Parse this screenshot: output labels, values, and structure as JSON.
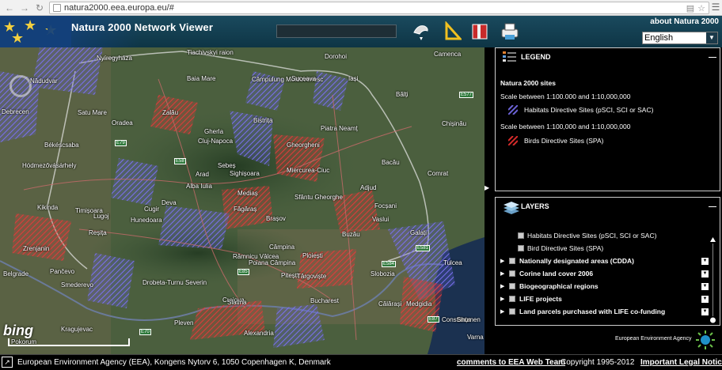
{
  "browser": {
    "url": "natura2000.eea.europa.eu/#",
    "back_icon": "back-arrow-icon",
    "forward_icon": "forward-arrow-icon",
    "reload_icon": "reload-icon"
  },
  "header": {
    "title": "Natura 2000 Network Viewer",
    "about_link": "about Natura 2000",
    "language": "English",
    "tools": [
      "map-tools-icon",
      "measure-icon",
      "bookmark-icon",
      "print-icon"
    ]
  },
  "map": {
    "provider": "bing",
    "cities": [
      {
        "name": "Tiachivskyi raion"
      },
      {
        "name": "Dorohoi"
      },
      {
        "name": "Camenca"
      },
      {
        "name": "Nyíregyháza"
      },
      {
        "name": "Baia Mare"
      },
      {
        "name": "Câmpulung Moldovenesc"
      },
      {
        "name": "Suceava"
      },
      {
        "name": "Iași"
      },
      {
        "name": "Bălți"
      },
      {
        "name": "Nădudvar"
      },
      {
        "name": "Debrecen"
      },
      {
        "name": "Satu Mare"
      },
      {
        "name": "Zalău"
      },
      {
        "name": "Bistrița"
      },
      {
        "name": "Oradea"
      },
      {
        "name": "Gherla"
      },
      {
        "name": "Cluj-Napoca"
      },
      {
        "name": "Piatra Neamț"
      },
      {
        "name": "Chișinău"
      },
      {
        "name": "Békéscsaba"
      },
      {
        "name": "Gheorgheni"
      },
      {
        "name": "Bacău"
      },
      {
        "name": "Hódmezővásárhely"
      },
      {
        "name": "Arad"
      },
      {
        "name": "Miercurea-Ciuc"
      },
      {
        "name": "Comrat"
      },
      {
        "name": "Kikinda"
      },
      {
        "name": "Timișoara"
      },
      {
        "name": "Deva"
      },
      {
        "name": "Alba Iulia"
      },
      {
        "name": "Sfântu Gheorghe"
      },
      {
        "name": "Adjud"
      },
      {
        "name": "Focșani"
      },
      {
        "name": "Brașov"
      },
      {
        "name": "Râmnicu Vâlcea"
      },
      {
        "name": "Câmpina"
      },
      {
        "name": "Buzău"
      },
      {
        "name": "Galați"
      },
      {
        "name": "Tulcea"
      },
      {
        "name": "Ploiești"
      },
      {
        "name": "Pitești"
      },
      {
        "name": "Târgoviște"
      },
      {
        "name": "Poiana Câmpina"
      },
      {
        "name": "Zrenjanin"
      },
      {
        "name": "Pančevo"
      },
      {
        "name": "Belgrade"
      },
      {
        "name": "Smederevo"
      },
      {
        "name": "Drobeta-Turnu Severin"
      },
      {
        "name": "Craiova"
      },
      {
        "name": "Slatina"
      },
      {
        "name": "Bucharest"
      },
      {
        "name": "Medgidia"
      },
      {
        "name": "Constanța"
      },
      {
        "name": "Alexandria"
      },
      {
        "name": "Kragujevac"
      },
      {
        "name": "Pleven"
      },
      {
        "name": "Shumen"
      },
      {
        "name": "Varna"
      },
      {
        "name": "Lugoj"
      },
      {
        "name": "Sebeș"
      },
      {
        "name": "Vaslui"
      },
      {
        "name": "Hunedoara"
      },
      {
        "name": "Reșița"
      },
      {
        "name": "Cugir"
      },
      {
        "name": "Sighișoara"
      },
      {
        "name": "Mediaș"
      },
      {
        "name": "Făgăraș"
      },
      {
        "name": "Pokorum"
      },
      {
        "name": "Slobozia"
      },
      {
        "name": "Călărași"
      }
    ],
    "roads": [
      "E79",
      "E58",
      "E85",
      "E577",
      "E581",
      "E584",
      "E87",
      "E70"
    ],
    "scale_label": "100 km"
  },
  "legend": {
    "title": "LEGEND",
    "section": "Natura 2000 sites",
    "scale1": "Scale between 1:100.000 and 1:10,000,000",
    "item1": "Habitats Directive Sites (pSCI, SCI or SAC)",
    "scale2": "Scale between 1:100,000 and 1:10,000,000",
    "item2": "Birds Directive Sites (SPA)",
    "colors": {
      "habitats": "#6c63d6",
      "birds": "#d62b2b"
    }
  },
  "layers": {
    "title": "LAYERS",
    "sublayers": [
      {
        "label": "Habitats Directive Sites (pSCI, SCI or SAC)",
        "checked": true
      },
      {
        "label": "Bird Directive Sites (SPA)",
        "checked": true
      }
    ],
    "groups": [
      {
        "label": "Nationally designated areas (CDDA)"
      },
      {
        "label": "Corine land cover 2006"
      },
      {
        "label": "Biogeographical regions"
      },
      {
        "label": "LIFE projects"
      },
      {
        "label": "Land parcels purchased with LIFE co-funding"
      }
    ]
  },
  "eea_label": "European Environment Agency",
  "footer": {
    "address": "European Environment Agency (EEA), Kongens Nytorv 6, 1050 Copenhagen K, Denmark",
    "comments": "comments to EEA Web Team",
    "copyright": "Copyright 1995-2012",
    "legal": "Important Legal Notice"
  }
}
